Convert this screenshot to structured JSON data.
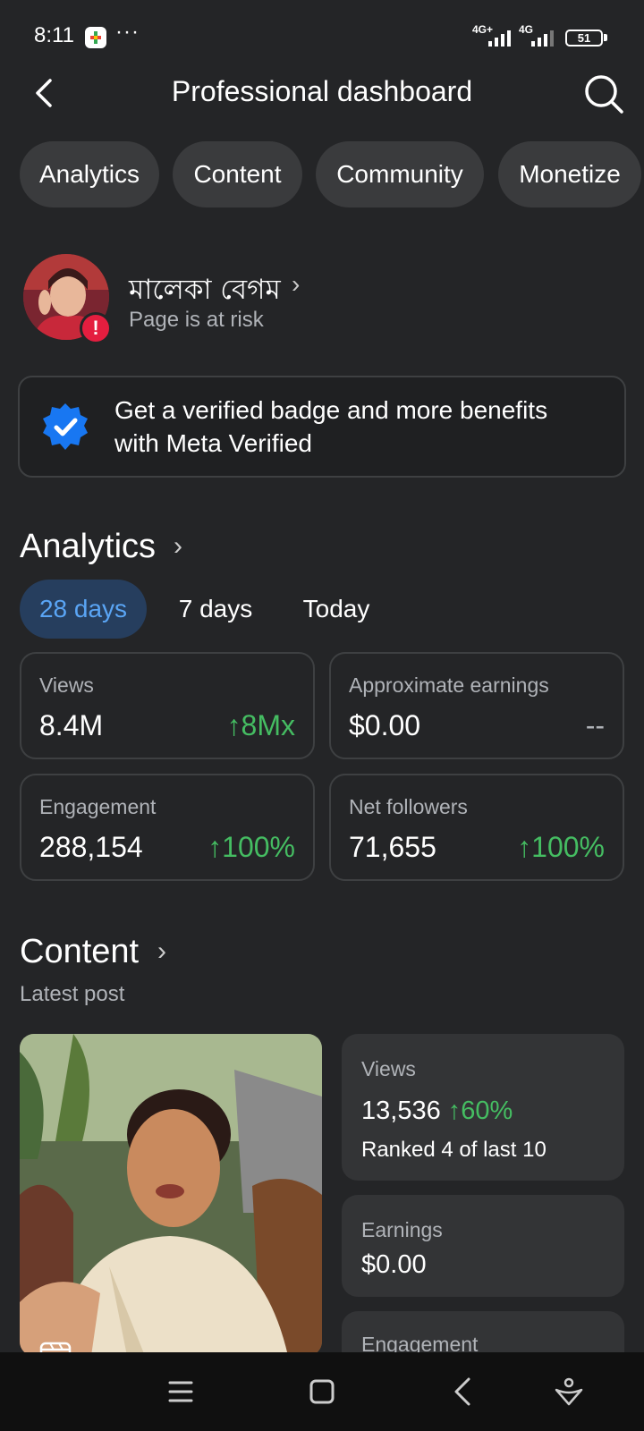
{
  "status_bar": {
    "time": "8:11",
    "more": "···",
    "network_1": "4G+",
    "network_2": "4G",
    "battery": "51"
  },
  "header": {
    "title": "Professional dashboard"
  },
  "tabs": [
    {
      "label": "Analytics"
    },
    {
      "label": "Content"
    },
    {
      "label": "Community"
    },
    {
      "label": "Monetize"
    }
  ],
  "profile": {
    "name": "মালেকা বেগম",
    "status": "Page is at risk",
    "alert": "!"
  },
  "verified_promo": {
    "text": "Get a verified badge and more benefits with Meta Verified"
  },
  "analytics": {
    "title": "Analytics",
    "periods": [
      {
        "label": "28 days",
        "active": true
      },
      {
        "label": "7 days",
        "active": false
      },
      {
        "label": "Today",
        "active": false
      }
    ],
    "metrics": [
      {
        "label": "Views",
        "value": "8.4M",
        "change": "↑8Mx"
      },
      {
        "label": "Approximate earnings",
        "value": "$0.00",
        "change": "--"
      },
      {
        "label": "Engagement",
        "value": "288,154",
        "change": "↑100%"
      },
      {
        "label": "Net followers",
        "value": "71,655",
        "change": "↑100%"
      }
    ]
  },
  "content": {
    "title": "Content",
    "subtitle": "Latest post",
    "post_stats": {
      "views_label": "Views",
      "views_value": "13,536",
      "views_change": "↑60%",
      "views_rank": "Ranked 4 of last 10",
      "earnings_label": "Earnings",
      "earnings_value": "$0.00",
      "engagement_label": "Engagement"
    }
  },
  "colors": {
    "background": "#242527",
    "positive": "#45bd62",
    "accent": "#5aa5f5",
    "alert": "#e41e3f"
  }
}
